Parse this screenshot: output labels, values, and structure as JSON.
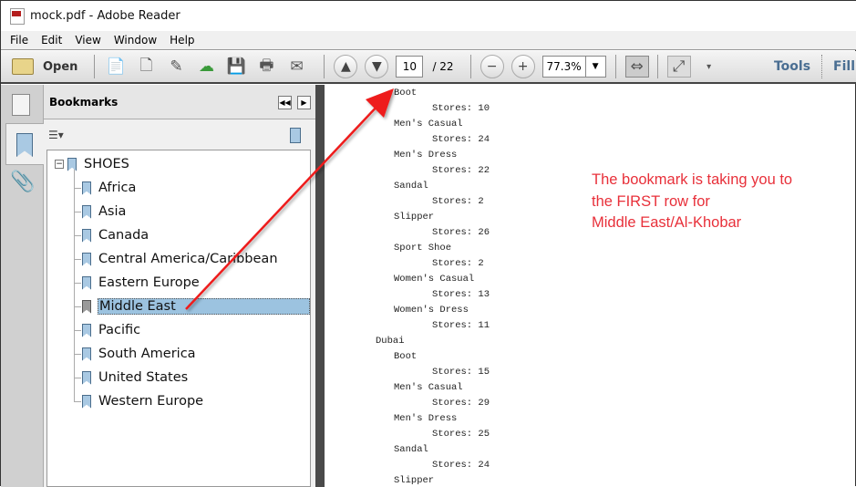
{
  "window": {
    "title": "mock.pdf - Adobe Reader"
  },
  "menu": [
    "File",
    "Edit",
    "View",
    "Window",
    "Help"
  ],
  "toolbar": {
    "open_label": "Open",
    "page_current": "10",
    "page_total": "/ 22",
    "zoom": "77.3%",
    "tools_label": "Tools",
    "fill_label": "Fill"
  },
  "bookmarks": {
    "title": "Bookmarks",
    "root": "SHOES",
    "items": [
      "Africa",
      "Asia",
      "Canada",
      "Central America/Caribbean",
      "Eastern Europe",
      "Middle East",
      "Pacific",
      "South America",
      "United States",
      "Western Europe"
    ],
    "selected": "Middle East"
  },
  "document": {
    "lines": [
      {
        "level": 2,
        "text": "Boot"
      },
      {
        "level": 3,
        "text": "Stores: 10"
      },
      {
        "level": 2,
        "text": "Men's Casual"
      },
      {
        "level": 3,
        "text": "Stores: 24"
      },
      {
        "level": 2,
        "text": "Men's Dress"
      },
      {
        "level": 3,
        "text": "Stores: 22"
      },
      {
        "level": 2,
        "text": "Sandal"
      },
      {
        "level": 3,
        "text": "Stores: 2"
      },
      {
        "level": 2,
        "text": "Slipper"
      },
      {
        "level": 3,
        "text": "Stores: 26"
      },
      {
        "level": 2,
        "text": "Sport Shoe"
      },
      {
        "level": 3,
        "text": "Stores: 2"
      },
      {
        "level": 2,
        "text": "Women's Casual"
      },
      {
        "level": 3,
        "text": "Stores: 13"
      },
      {
        "level": 2,
        "text": "Women's Dress"
      },
      {
        "level": 3,
        "text": "Stores: 11"
      },
      {
        "level": 1,
        "text": "Dubai"
      },
      {
        "level": 2,
        "text": "Boot"
      },
      {
        "level": 3,
        "text": "Stores: 15"
      },
      {
        "level": 2,
        "text": "Men's Casual"
      },
      {
        "level": 3,
        "text": "Stores: 29"
      },
      {
        "level": 2,
        "text": "Men's Dress"
      },
      {
        "level": 3,
        "text": "Stores: 25"
      },
      {
        "level": 2,
        "text": "Sandal"
      },
      {
        "level": 3,
        "text": "Stores: 24"
      },
      {
        "level": 2,
        "text": "Slipper"
      }
    ]
  },
  "annotation": {
    "lines": [
      "The bookmark is taking you to",
      "the FIRST row for",
      "Middle East/Al-Khobar"
    ],
    "color": "#e8303a"
  }
}
